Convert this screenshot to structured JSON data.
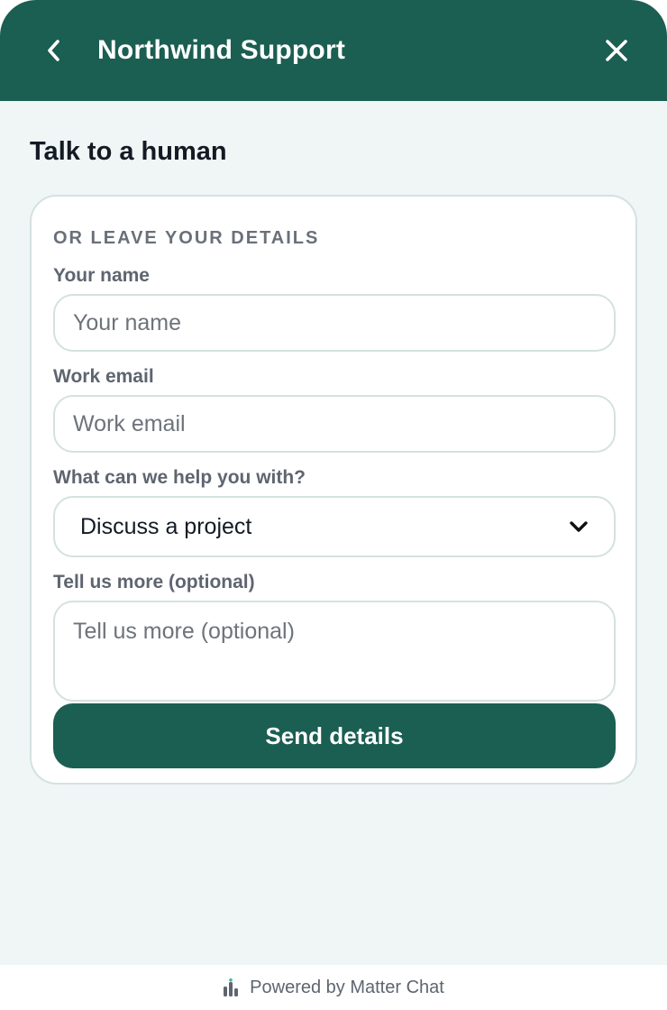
{
  "header": {
    "title": "Northwind Support",
    "back_icon": "chevron-left-icon",
    "close_icon": "close-icon"
  },
  "section": {
    "title": "Talk to a human"
  },
  "form": {
    "heading": "Or leave your details",
    "name": {
      "label": "Your name",
      "placeholder": "Your name",
      "value": ""
    },
    "email": {
      "label": "Work email",
      "placeholder": "Work email",
      "value": ""
    },
    "topic": {
      "label": "What can we help you with?",
      "selected": "Discuss a project"
    },
    "message": {
      "label": "Tell us more (optional)",
      "placeholder": "Tell us more (optional)",
      "value": ""
    },
    "submit_label": "Send details"
  },
  "footer": {
    "text": "Powered by Matter Chat",
    "icon": "bar-chart-icon"
  },
  "colors": {
    "brand": "#1b5e52",
    "background": "#f0f5f5",
    "border": "#d3e2e1",
    "text_dark": "#141a24",
    "text_muted": "#5e6570"
  }
}
